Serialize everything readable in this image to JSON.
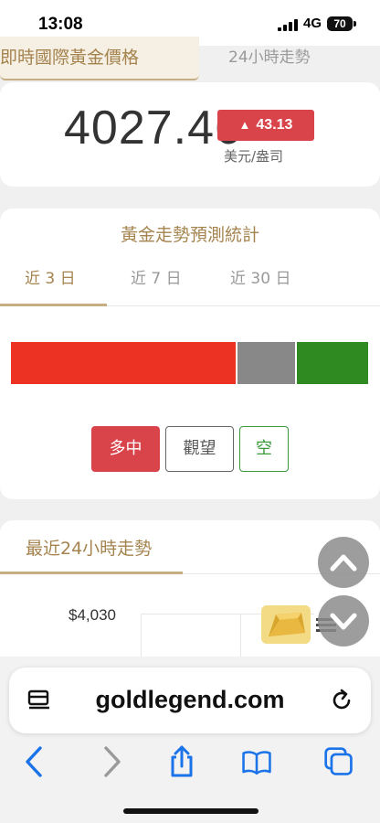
{
  "status_bar": {
    "time": "13:08",
    "network": "4G",
    "battery": "70"
  },
  "top_tabs": {
    "active_label": "即時國際黃金價格",
    "other_label": "24小時走勢"
  },
  "price": {
    "value": "4027.46",
    "change": "43.13",
    "change_arrow": "▲",
    "unit": "美元/盎司",
    "up_color": "#d9434a"
  },
  "forecast": {
    "title": "黃金走勢預測統計",
    "periods": [
      "近 3 日",
      "近 7 日",
      "近 30 日"
    ],
    "active_period": "近 3 日",
    "distribution": {
      "bullish": 0.63,
      "neutral": 0.17,
      "bearish": 0.2
    },
    "colors": {
      "bullish": "#ec3223",
      "neutral": "#888888",
      "bearish": "#2f8a22"
    },
    "buttons": {
      "bullish": "多中",
      "neutral": "觀望",
      "bearish": "空"
    }
  },
  "trend": {
    "title": "最近24小時走勢",
    "y_label": "$4,030"
  },
  "browser": {
    "url": "goldlegend.com"
  },
  "icons": {
    "scroll_up": "chevron-up-icon",
    "scroll_down": "chevron-down-icon",
    "reader": "reader-mode-icon",
    "reload": "reload-icon",
    "back": "back-arrow-icon",
    "forward": "forward-arrow-icon",
    "share": "share-icon",
    "bookmarks": "bookmarks-icon",
    "tabs": "tabs-icon"
  }
}
